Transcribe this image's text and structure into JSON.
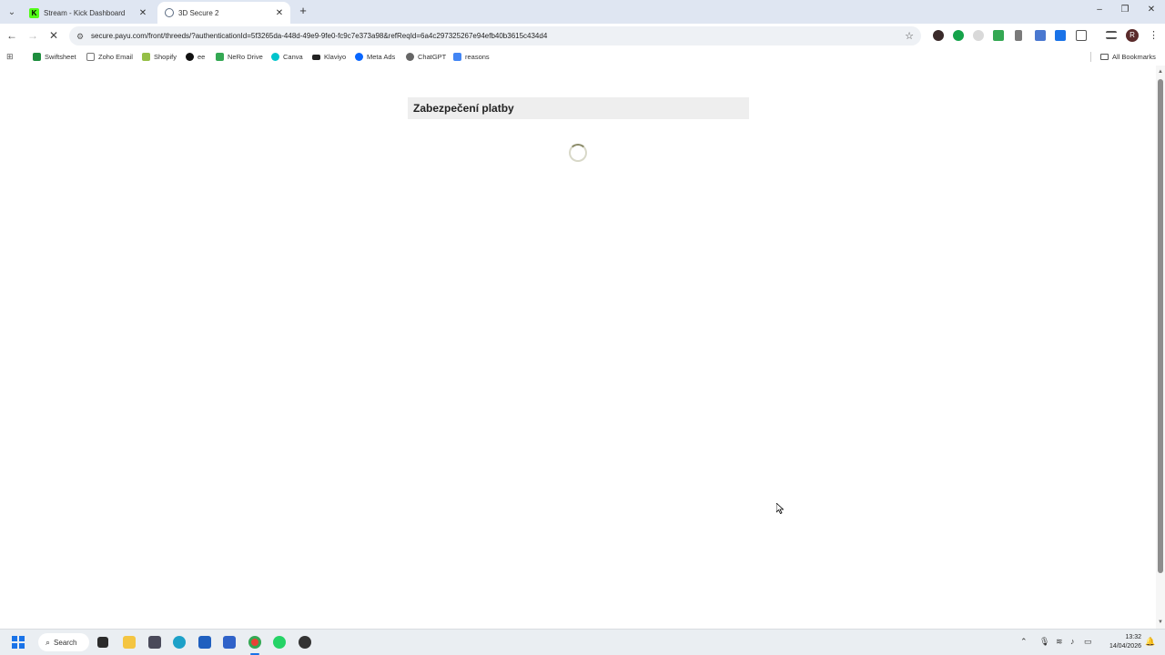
{
  "browser": {
    "tabs": [
      {
        "title": "Stream - Kick Dashboard",
        "active": false
      },
      {
        "title": "3D Secure 2",
        "active": true
      }
    ],
    "new_tab": "+",
    "address": "secure.payu.com/front/threeds/?authenticationId=5f3265da-448d-49e9-9fe0-fc9c7e373a98&refReqId=6a4c297325267e94efb40b3615c434d4",
    "profile_initial": "R",
    "bookmarks": [
      {
        "label": "Swiftsheet",
        "color": "#1e8e3e"
      },
      {
        "label": "Zoho Email",
        "color": "#888888"
      },
      {
        "label": "Shopify",
        "color": "#95bf47"
      },
      {
        "label": "ee",
        "color": "#111111"
      },
      {
        "label": "NeRo Drive",
        "color": "#34a853"
      },
      {
        "label": "Canva",
        "color": "#00c4cc"
      },
      {
        "label": "Klaviyo",
        "color": "#222222"
      },
      {
        "label": "Meta Ads",
        "color": "#0866ff"
      },
      {
        "label": "ChatGPT",
        "color": "#666666"
      },
      {
        "label": "reasons",
        "color": "#4285f4"
      }
    ],
    "all_bookmarks": "All Bookmarks"
  },
  "page": {
    "title": "Zabezpečení platby",
    "loading": true
  },
  "taskbar": {
    "search_label": "Search",
    "time": "13:32",
    "date": "14/04/2026"
  },
  "icons": {
    "back": "arrow-left-icon",
    "forward": "arrow-right-icon",
    "stop": "stop-loading-icon",
    "bookmark_star": "star-icon",
    "menu": "more-vert-icon"
  }
}
